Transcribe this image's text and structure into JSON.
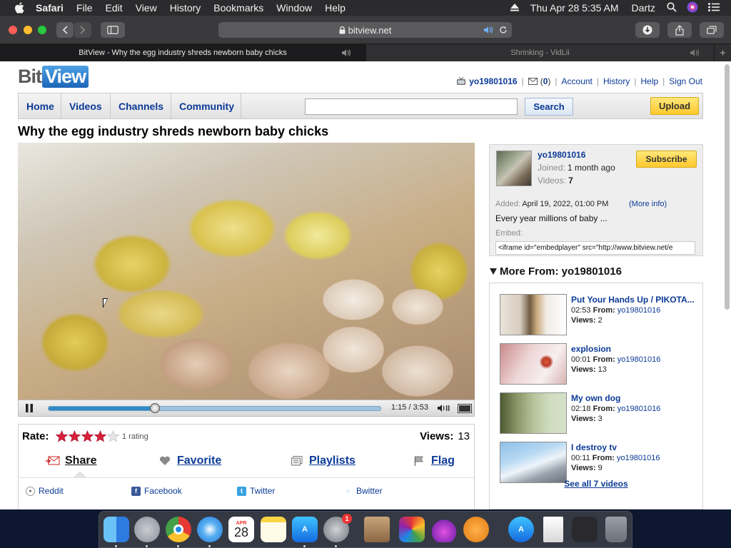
{
  "menubar": {
    "app": "Safari",
    "items": [
      "File",
      "Edit",
      "View",
      "History",
      "Bookmarks",
      "Window",
      "Help"
    ],
    "clock": "Thu Apr 28  5:35 AM",
    "user": "Dartz"
  },
  "toolbar": {
    "url": "bitview.net"
  },
  "tabs": [
    {
      "title": "BitView - Why the egg industry shreds newborn baby chicks"
    },
    {
      "title": "Shrinking - VidLii"
    }
  ],
  "site": {
    "logo_a": "Bit",
    "logo_b": "View",
    "user": {
      "username": "yo19801016",
      "inbox_count": "0",
      "links": [
        "Account",
        "History",
        "Help",
        "Sign Out"
      ]
    },
    "nav": [
      "Home",
      "Videos",
      "Channels",
      "Community"
    ],
    "search_button": "Search",
    "upload_button": "Upload"
  },
  "video": {
    "title": "Why the egg industry shreds newborn baby chicks",
    "current_time": "1:15",
    "duration": "3:53",
    "time_display": "1:15 / 3:53",
    "progress": 0.32,
    "rate_label": "Rate:",
    "stars": 4,
    "rating_count": "1 rating",
    "views_label": "Views:",
    "views": "13",
    "actions": [
      "Share",
      "Favorite",
      "Playlists",
      "Flag"
    ],
    "share_targets": [
      "Reddit",
      "Facebook",
      "Twitter",
      "Bwitter"
    ]
  },
  "uploader": {
    "name": "yo19801016",
    "joined_label": "Joined:",
    "joined": "1 month ago",
    "videos_label": "Videos:",
    "videos": "7",
    "subscribe": "Subscribe",
    "added_label": "Added:",
    "added": "April 19, 2022, 01:00 PM",
    "more_info": "(More info)",
    "description": "Every year millions of baby ...",
    "embed_label": "Embed:",
    "embed_code": "<iframe id=\"embedplayer\" src=\"http://www.bitview.net/e"
  },
  "more_from": {
    "heading": "More From: yo19801016",
    "from_label": "From:",
    "views_label": "Views:",
    "items": [
      {
        "title": "Put Your Hands Up / PIKOTA...",
        "duration": "02:53",
        "author": "yo19801016",
        "views": "2"
      },
      {
        "title": "explosion",
        "duration": "00:01",
        "author": "yo19801016",
        "views": "13"
      },
      {
        "title": "My own dog",
        "duration": "02:18",
        "author": "yo19801016",
        "views": "3"
      },
      {
        "title": "I destroy tv",
        "duration": "00:11",
        "author": "yo19801016",
        "views": "9"
      }
    ],
    "see_all": "See all 7 videos"
  },
  "dock": {
    "calendar_month": "APR",
    "calendar_day": "28",
    "settings_badge": "1"
  }
}
